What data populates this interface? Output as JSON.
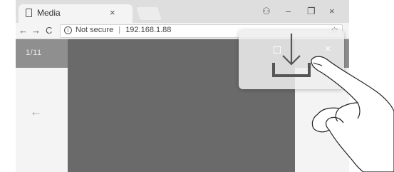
{
  "tab": {
    "title": "Media",
    "close": "×"
  },
  "window": {
    "account": "⚇",
    "minimize": "–",
    "maximize": "❐",
    "close": "×"
  },
  "nav": {
    "back": "←",
    "forward": "→",
    "reload": "C"
  },
  "address": {
    "security": "Not secure",
    "separator": "|",
    "url": "192.168.1.88",
    "bookmark": "☆"
  },
  "viewer": {
    "counter": "1/11",
    "prev": "←",
    "next": "→"
  },
  "callout": {
    "close": "×"
  }
}
